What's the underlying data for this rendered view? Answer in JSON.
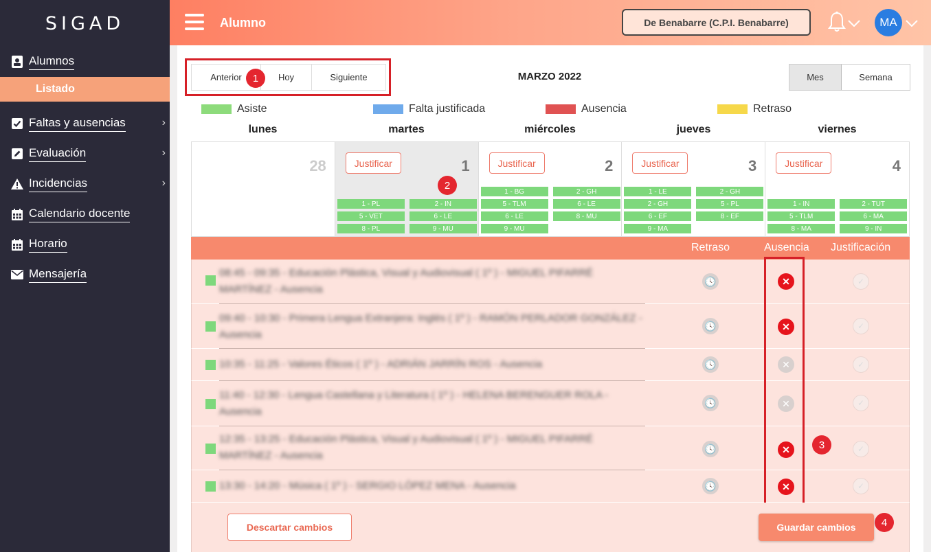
{
  "app": {
    "brand": "SIGAD"
  },
  "sidebar": {
    "items": [
      {
        "label": "Alumnos",
        "icon": "student-icon"
      },
      {
        "label": "Listado",
        "active": true
      },
      {
        "label": "Faltas y ausencias",
        "icon": "checkbox-icon",
        "has_submenu": true
      },
      {
        "label": "Evaluación",
        "icon": "edit-icon",
        "has_submenu": true
      },
      {
        "label": "Incidencias",
        "icon": "warning-icon",
        "has_submenu": true
      },
      {
        "label": "Calendario docente",
        "icon": "calendar-icon"
      },
      {
        "label": "Horario",
        "icon": "calendar-icon"
      },
      {
        "label": "Mensajería",
        "icon": "envelope-icon"
      }
    ]
  },
  "header": {
    "title": "Alumno",
    "school": "De Benabarre (C.P.I. Benabarre)",
    "user_initials": "MA"
  },
  "calendar": {
    "nav": {
      "prev": "Anterior",
      "today": "Hoy",
      "next": "Siguiente"
    },
    "title": "MARZO 2022",
    "views": {
      "month": "Mes",
      "week": "Semana",
      "active": "Mes"
    },
    "legend": [
      {
        "label": "Asiste",
        "color": "#8ddb7b"
      },
      {
        "label": "Falta justificada",
        "color": "#6faaeb"
      },
      {
        "label": "Ausencia",
        "color": "#e05252"
      },
      {
        "label": "Retraso",
        "color": "#f6d84a"
      }
    ],
    "weekdays": [
      "lunes",
      "martes",
      "miércoles",
      "jueves",
      "viernes"
    ],
    "justify_label": "Justificar",
    "days": [
      {
        "day": "28",
        "faded": true,
        "justify": false,
        "chips": []
      },
      {
        "day": "1",
        "selected": true,
        "justify": true,
        "chips": [
          "1 - PL",
          "2 - IN",
          "5 - VET",
          "6 - LE",
          "8 - PL",
          "9 - MU"
        ]
      },
      {
        "day": "2",
        "justify": true,
        "chips": [
          "1 - BG",
          "2 - GH",
          "5 - TLM",
          "6 - LE",
          "6 - LE",
          "8 - MU",
          "9 - MU"
        ]
      },
      {
        "day": "3",
        "justify": true,
        "chips": [
          "1 - LE",
          "2 - GH",
          "2 - GH",
          "5 - PL",
          "6 - EF",
          "8 - EF",
          "9 - MA"
        ]
      },
      {
        "day": "4",
        "justify": true,
        "chips": [
          "1 - IN",
          "2 - TUT",
          "5 - TLM",
          "6 - MA",
          "8 - MA",
          "9 - IN"
        ]
      }
    ]
  },
  "table": {
    "columns": {
      "delay": "Retraso",
      "absence": "Ausencia",
      "justification": "Justificación"
    },
    "rows": [
      {
        "text": "08:45 - 09:35 - Educación Plástica, Visual y Audiovisual ( 1º ) - MIGUEL PIFARRÉ MARTÍNEZ - Ausencia",
        "absence": true
      },
      {
        "text": "09:40 - 10:30 - Primera Lengua Extranjera: Inglés ( 1º ) - RAMÓN PERLADOR GONZÁLEZ - Ausencia",
        "absence": true
      },
      {
        "text": "10:35 - 11:25 - Valores Éticos ( 1º ) - ADRIÁN JARRÍN ROS - Ausencia",
        "absence": false
      },
      {
        "text": "11:40 - 12:30 - Lengua Castellana y Literatura ( 1º ) - HELENA BERENGUER ROLA - Ausencia",
        "absence": false
      },
      {
        "text": "12:35 - 13:25 - Educación Plástica, Visual y Audiovisual ( 1º ) - MIGUEL PIFARRÉ MARTÍNEZ - Ausencia",
        "absence": true
      },
      {
        "text": "13:30 - 14:20 - Música ( 1º ) - SERGIO LÓPEZ MENA - Ausencia",
        "absence": true
      }
    ],
    "discard": "Descartar cambios",
    "save": "Guardar cambios"
  },
  "annotations": [
    "1",
    "2",
    "3",
    "4"
  ]
}
